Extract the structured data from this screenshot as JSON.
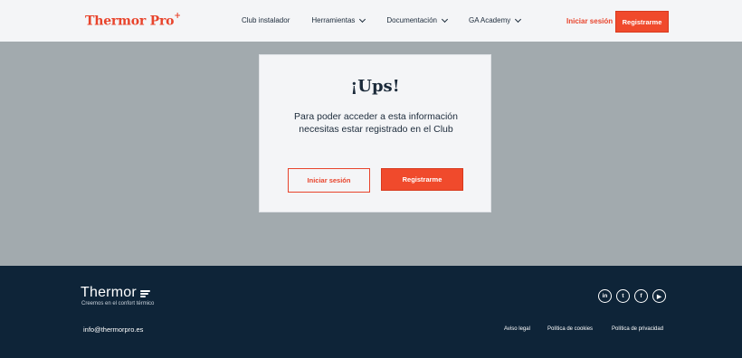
{
  "header": {
    "logo_text": "Thermor Pro",
    "logo_sup": "+",
    "nav": [
      {
        "label": "Club instalador",
        "has_dropdown": false
      },
      {
        "label": "Herramientas",
        "has_dropdown": true
      },
      {
        "label": "Documentación",
        "has_dropdown": true
      },
      {
        "label": "GA Academy",
        "has_dropdown": true
      }
    ],
    "login_label": "Iniciar sesión",
    "register_label": "Registrarme"
  },
  "modal": {
    "title": "¡Ups!",
    "message": "Para poder acceder a esta información necesitas estar registrado en el Club",
    "login_label": "Iniciar sesión",
    "register_label": "Registrarme"
  },
  "footer": {
    "logo_text": "Thermor",
    "tagline": "Creemos en el confort térmico",
    "email": "info@thermorpro.es",
    "socials": [
      {
        "icon": "linkedin-icon",
        "glyph": "in"
      },
      {
        "icon": "twitter-icon",
        "glyph": "t"
      },
      {
        "icon": "facebook-icon",
        "glyph": "f"
      },
      {
        "icon": "youtube-icon",
        "glyph": "▶"
      }
    ],
    "links": {
      "legal": "Aviso legal",
      "cookies": "Política de cookies",
      "privacy": "Política de privacidad"
    }
  },
  "colors": {
    "accent": "#f04a2c",
    "footer_bg": "#0e2438",
    "overlay_bg": "#a2aaae",
    "header_bg": "#f4f5f7"
  }
}
